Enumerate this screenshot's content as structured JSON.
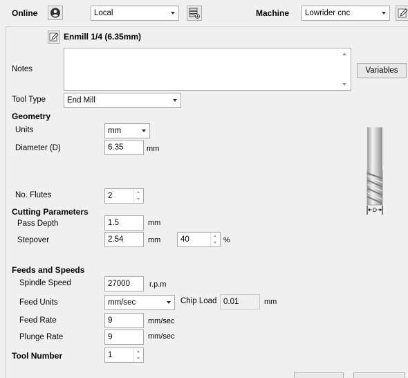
{
  "toolbar": {
    "online_label": "Online",
    "online_icon": "user-circle-icon",
    "source_value": "Local",
    "library_icon": "tool-library-icon",
    "machine_label": "Machine",
    "machine_value": "Lowrider cnc",
    "edit_machine_icon": "edit-icon"
  },
  "tool": {
    "edit_icon": "edit-icon",
    "name": "Enmill 1/4 (6.35mm)",
    "notes_label": "Notes",
    "notes_value": "",
    "variables_label": "Variables",
    "tool_type_label": "Tool Type",
    "tool_type_value": "End Mill"
  },
  "geometry": {
    "heading": "Geometry",
    "units_label": "Units",
    "units_value": "mm",
    "diameter_label": "Diameter (D)",
    "diameter_value": "6.35",
    "diameter_unit": "mm",
    "flutes_label": "No. Flutes",
    "flutes_value": "2",
    "diagram_label": "D"
  },
  "cutting": {
    "heading": "Cutting Parameters",
    "pass_depth_label": "Pass Depth",
    "pass_depth_value": "1.5",
    "pass_depth_unit": "mm",
    "stepover_label": "Stepover",
    "stepover_value": "2.54",
    "stepover_unit": "mm",
    "stepover_percent_value": "40",
    "stepover_percent_unit": "%"
  },
  "feeds": {
    "heading": "Feeds and Speeds",
    "spindle_label": "Spindle Speed",
    "spindle_value": "27000",
    "spindle_unit": "r.p.m",
    "feed_units_label": "Feed Units",
    "feed_units_value": "mm/sec",
    "chip_load_label": "Chip Load",
    "chip_load_value": "0.01",
    "chip_load_unit": "mm",
    "feed_rate_label": "Feed Rate",
    "feed_rate_value": "9",
    "feed_rate_unit": "mm/sec",
    "plunge_rate_label": "Plunge Rate",
    "plunge_rate_value": "9",
    "plunge_rate_unit": "mm/sec"
  },
  "tool_number": {
    "label": "Tool Number",
    "value": "1"
  }
}
